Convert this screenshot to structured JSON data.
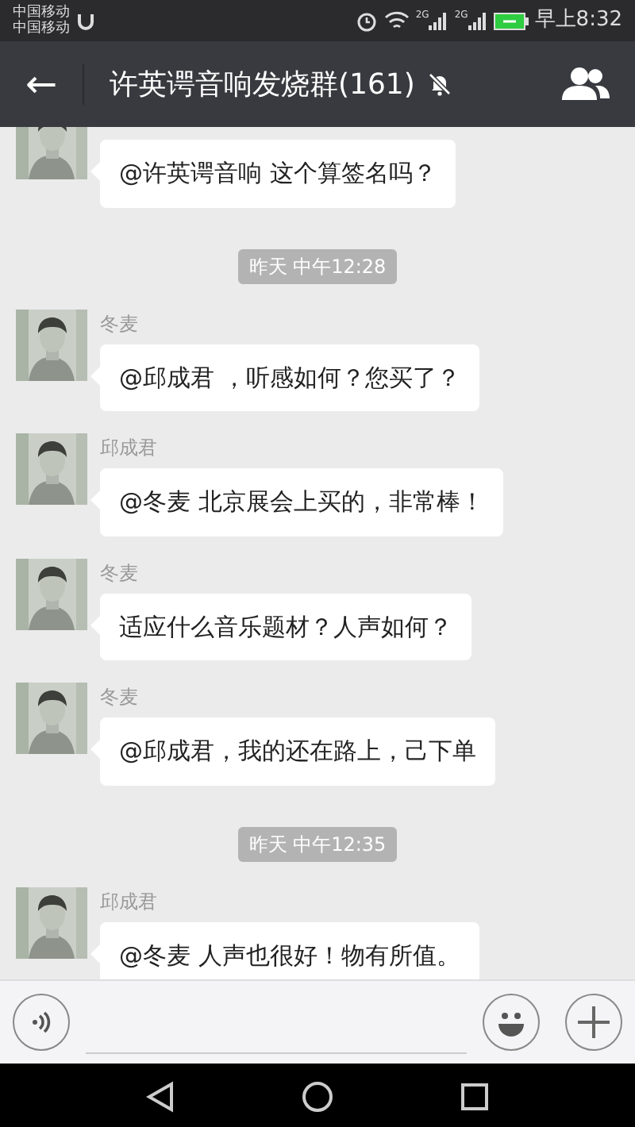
{
  "status_bar": {
    "carriers": [
      "中国移动",
      "中国移动"
    ],
    "network_labels": [
      "2G",
      "2G"
    ],
    "time": "早上8:32"
  },
  "header": {
    "back": "←",
    "title": "许英谔音响发烧群(161)",
    "muted": true
  },
  "chat": [
    {
      "kind": "message",
      "text": "@许英谔音响 这个算签名吗？"
    },
    {
      "kind": "time",
      "text": "昨天 中午12:28"
    },
    {
      "kind": "message",
      "sender": "冬麦",
      "text": "@邱成君 ，听感如何？您买了？"
    },
    {
      "kind": "message",
      "sender": "邱成君",
      "text": "@冬麦 北京展会上买的，非常棒！"
    },
    {
      "kind": "message",
      "sender": "冬麦",
      "text": "适应什么音乐题材？人声如何？"
    },
    {
      "kind": "message",
      "sender": "冬麦",
      "text": "@邱成君，我的还在路上，己下单"
    },
    {
      "kind": "time",
      "text": "昨天 中午12:35"
    },
    {
      "kind": "message",
      "sender": "邱成君",
      "text": "@冬麦 人声也很好！物有所值。"
    }
  ]
}
